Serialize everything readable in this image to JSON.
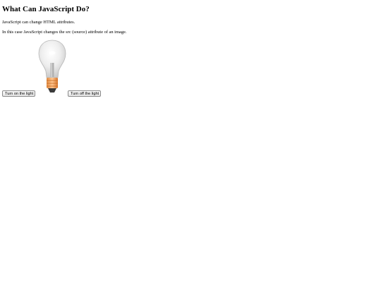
{
  "heading": "What Can JavaScript Do?",
  "intro": "JavaScript can change HTML attributes.",
  "description": "In this case JavaScript changes the src (source) attribute of an image.",
  "buttons": {
    "on_label": "Turn on the light",
    "off_label": "Turn off the light"
  },
  "bulb": {
    "state": "off",
    "icon": "lightbulb-icon",
    "glass_color": "#d9d9d9",
    "base_color": "#f0a060"
  }
}
